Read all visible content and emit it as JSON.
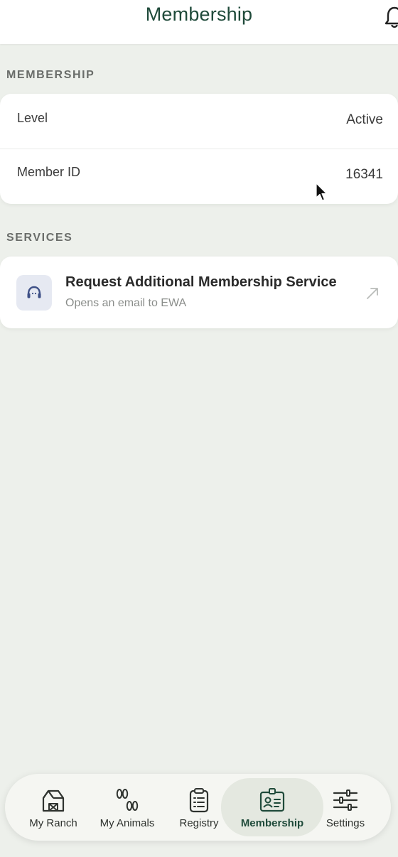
{
  "header": {
    "title": "Membership",
    "bell_icon": "bell-icon"
  },
  "membership_section": {
    "label": "MEMBERSHIP",
    "rows": [
      {
        "label": "Level",
        "value": "Active"
      },
      {
        "label": "Member ID",
        "value": "16341"
      }
    ]
  },
  "services_section": {
    "label": "SERVICES",
    "items": [
      {
        "icon": "headset-icon",
        "title": "Request Additional Membership Service",
        "subtitle": "Opens an email to EWA",
        "trailing_icon": "external-link-icon"
      }
    ]
  },
  "tabbar": {
    "active": "Membership",
    "tabs": [
      {
        "label": "My Ranch",
        "icon": "barn-icon"
      },
      {
        "label": "My Animals",
        "icon": "hoofprints-icon"
      },
      {
        "label": "Registry",
        "icon": "clipboard-icon"
      },
      {
        "label": "Membership",
        "icon": "id-card-icon"
      },
      {
        "label": "Settings",
        "icon": "sliders-icon"
      }
    ]
  },
  "colors": {
    "brand_green": "#1f4a3a",
    "background": "#edf0eb",
    "card": "#ffffff",
    "icon_tile": "#e6e9f2",
    "icon_blue": "#3d4f86"
  }
}
